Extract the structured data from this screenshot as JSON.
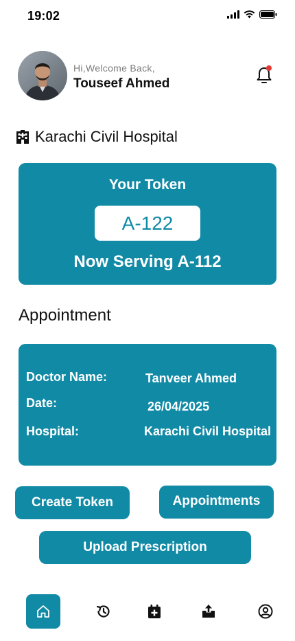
{
  "status_bar": {
    "time": "19:02"
  },
  "header": {
    "greeting": "Hi,Welcome Back,",
    "username": "Touseef Ahmed"
  },
  "hospital": {
    "name": "Karachi Civil Hospital"
  },
  "token_card": {
    "title": "Your Token",
    "token": "A-122",
    "now_serving": "Now Serving A-112"
  },
  "appointment": {
    "section_title": "Appointment",
    "rows": [
      {
        "label": "Doctor Name:",
        "value": "Tanveer Ahmed"
      },
      {
        "label": "Date:",
        "value": "26/04/2025"
      },
      {
        "label": "Hospital:",
        "value": "Karachi Civil Hospital"
      }
    ]
  },
  "actions": {
    "create_token": "Create Token",
    "appointments": "Appointments",
    "upload_prescription": "Upload Prescription"
  },
  "bottom_nav": [
    {
      "icon": "home-icon",
      "active": true
    },
    {
      "icon": "history-icon",
      "active": false
    },
    {
      "icon": "calendar-add-icon",
      "active": false
    },
    {
      "icon": "upload-icon",
      "active": false
    },
    {
      "icon": "profile-icon",
      "active": false
    }
  ],
  "colors": {
    "accent": "#118aa6",
    "notification_dot": "#e53935"
  }
}
